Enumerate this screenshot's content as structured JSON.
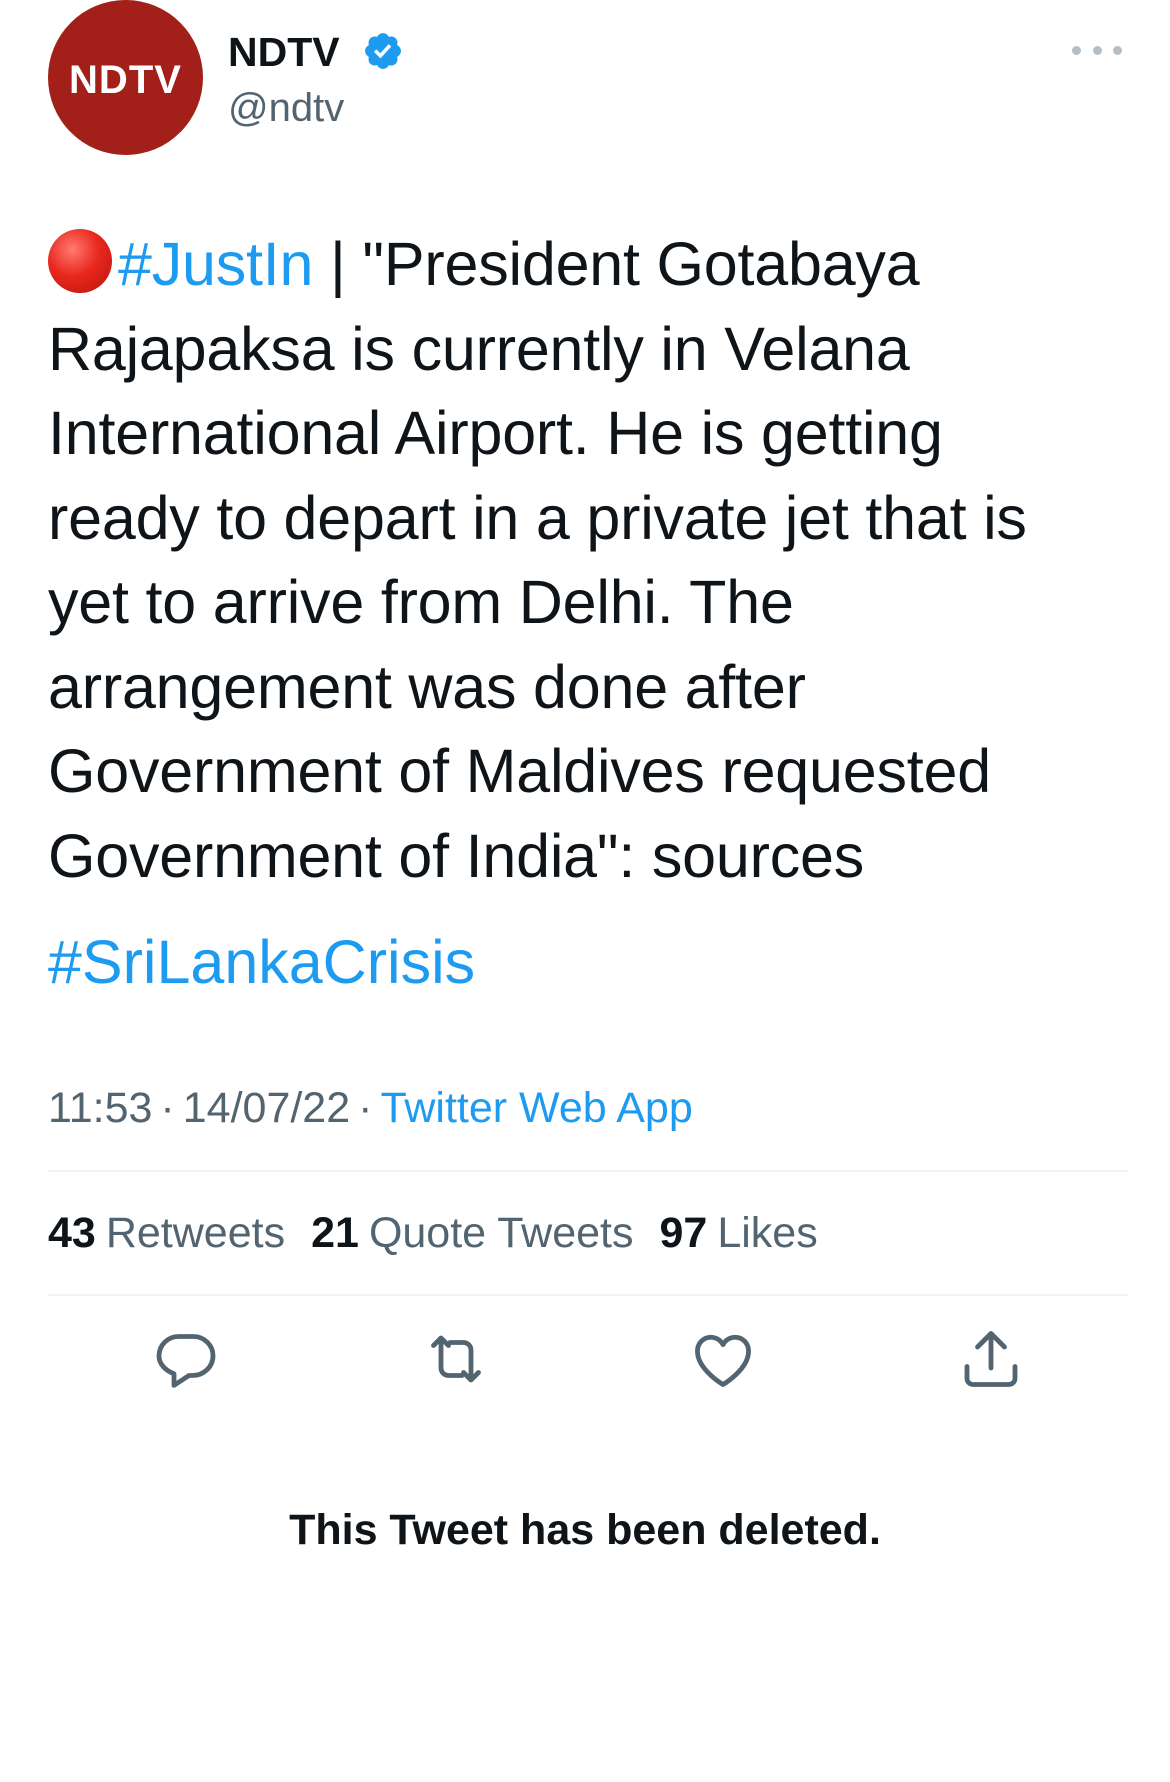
{
  "author": {
    "display_name": "NDTV",
    "handle": "@ndtv",
    "avatar_text": "NDTV",
    "verified": true,
    "avatar_color": "#a3201a"
  },
  "tweet": {
    "emoji": "red-circle",
    "hashtag_1": "#JustIn",
    "lines": [
      " | \"President Gotabaya",
      "Rajapaksa is currently in Velana",
      "International Airport. He is getting",
      "ready to depart in a private jet that is",
      "yet to arrive from Delhi. The",
      "arrangement was done after",
      "Government of Maldives requested",
      "Government of India\": sources"
    ],
    "hashtag_2": "#SriLankaCrisis"
  },
  "meta": {
    "time": "11:53",
    "date": "14/07/22",
    "separator": "·",
    "source": "Twitter Web App"
  },
  "stats": {
    "retweets_count": "43",
    "retweets_label": "Retweets",
    "quotes_count": "21",
    "quotes_label": "Quote Tweets",
    "likes_count": "97",
    "likes_label": "Likes"
  },
  "actions": [
    "reply-icon",
    "retweet-icon",
    "like-icon",
    "share-icon"
  ],
  "deleted_notice": "This Tweet has been deleted.",
  "colors": {
    "link": "#1d9bf0",
    "secondary_text": "#536471",
    "primary_text": "#0f1419",
    "divider": "#eff3f4"
  }
}
